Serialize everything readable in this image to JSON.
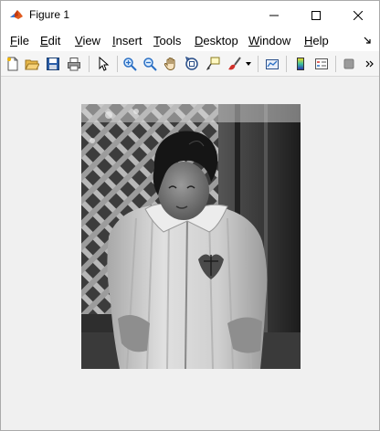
{
  "window": {
    "title": "Figure 1",
    "app_icon": "matlab-icon"
  },
  "menubar": {
    "items": [
      {
        "label": "File",
        "underline": "F"
      },
      {
        "label": "Edit",
        "underline": "E"
      },
      {
        "label": "View",
        "underline": "V"
      },
      {
        "label": "Insert",
        "underline": "I"
      },
      {
        "label": "Tools",
        "underline": "T"
      },
      {
        "label": "Desktop",
        "underline": "D"
      },
      {
        "label": "Window",
        "underline": "W"
      },
      {
        "label": "Help",
        "underline": "H"
      }
    ]
  },
  "toolbar": {
    "icons": [
      "new-figure-icon",
      "open-file-icon",
      "save-icon",
      "print-icon",
      "select-arrow-icon",
      "zoom-in-icon",
      "zoom-out-icon",
      "pan-hand-icon",
      "rotate-3d-icon",
      "data-cursor-icon",
      "brush-icon",
      "link-plot-icon",
      "colorbar-icon",
      "legend-icon",
      "hide-plot-tools-icon"
    ]
  },
  "figure": {
    "content": "grayscale-photo"
  }
}
